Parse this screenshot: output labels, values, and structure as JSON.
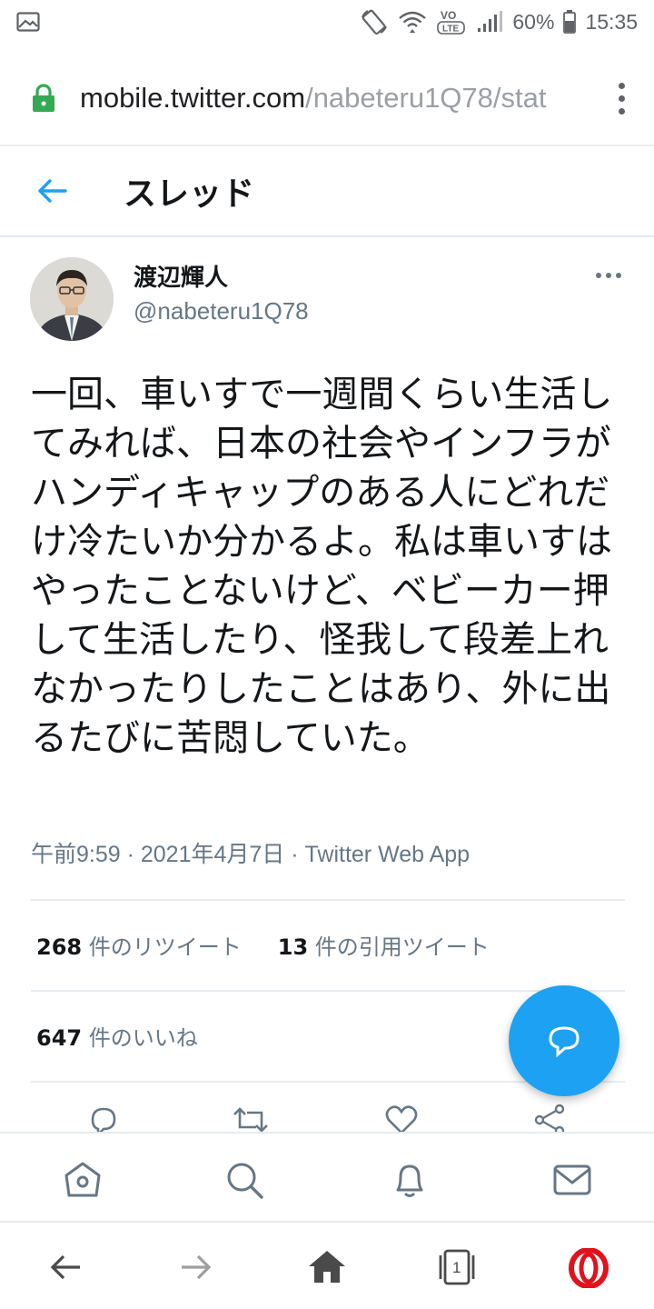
{
  "status_bar": {
    "battery_percent": "60%",
    "time": "15:35",
    "network": "VoLTE"
  },
  "browser": {
    "url_domain": "mobile.twitter.com",
    "url_path": "/nabeteru1Q78/stat"
  },
  "header": {
    "title": "スレッド"
  },
  "tweet": {
    "display_name": "渡辺輝人",
    "handle": "@nabeteru1Q78",
    "text": "一回、車いすで一週間くらい生活してみれば、日本の社会やインフラがハンディキャップのある人にどれだけ冷たいか分かるよ。私は車いすはやったことないけど、ベビーカー押して生活したり、怪我して段差上れなかったりしたことはあり、外に出るたびに苦悶していた。",
    "meta": "午前9:59 · 2021年4月7日 · Twitter Web App"
  },
  "stats": {
    "retweets_count": "268",
    "retweets_label": " 件のリツイート",
    "quotes_count": "13",
    "quotes_label": " 件の引用ツイート",
    "likes_count": "647",
    "likes_label": " 件のいいね"
  },
  "browser_nav": {
    "tab_count": "1"
  },
  "colors": {
    "accent": "#1da1f2",
    "text": "#14171a",
    "secondary_text": "#657786",
    "secure_lock": "#34a853",
    "opera_red": "#e0121b"
  },
  "icons": [
    "image-icon",
    "rotate-icon",
    "wifi-icon",
    "volte-icon",
    "signal-icon",
    "battery-icon",
    "lock-icon",
    "kebab-menu-icon",
    "back-arrow-icon",
    "more-icon",
    "reply-icon",
    "retweet-icon",
    "like-icon",
    "share-icon",
    "compose-icon",
    "home-icon",
    "search-icon",
    "notifications-icon",
    "messages-icon",
    "browser-back-icon",
    "browser-forward-icon",
    "browser-home-icon",
    "tabs-icon",
    "opera-icon"
  ]
}
